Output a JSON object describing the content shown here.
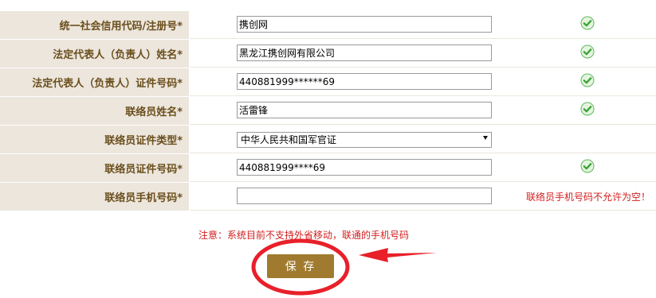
{
  "form": {
    "rows": [
      {
        "label": "统一社会信用代码/注册号*",
        "value": "携创网",
        "status": "valid"
      },
      {
        "label": "法定代表人（负责人）姓名*",
        "value": "黑龙江携创网有限公司",
        "status": "valid"
      },
      {
        "label": "法定代表人（负责人）证件号码*",
        "value": "440881999******69",
        "status": "valid"
      },
      {
        "label": "联络员姓名*",
        "value": "活雷锋",
        "status": "valid"
      },
      {
        "label": "联络员证件类型*",
        "value": "中华人民共和国军官证",
        "status": "none"
      },
      {
        "label": "联络员证件号码*",
        "value": "440881999****69",
        "status": "valid"
      },
      {
        "label": "联络员手机号码*",
        "value": "",
        "status": "error"
      }
    ],
    "error_message": "联络员手机号码不允许为空！"
  },
  "notice": "注意：系统目前不支持外省移动，联通的手机号码",
  "save_label": "保 存",
  "colors": {
    "label_bg": "#ece6dd",
    "label_text": "#6b4f1d",
    "save_button": "#a07b2f",
    "error_text": "#d22020",
    "annotation": "#e8202a",
    "check_green": "#3aa335"
  },
  "icons": {
    "valid": "check-icon",
    "select": "dropdown-arrow-icon"
  }
}
